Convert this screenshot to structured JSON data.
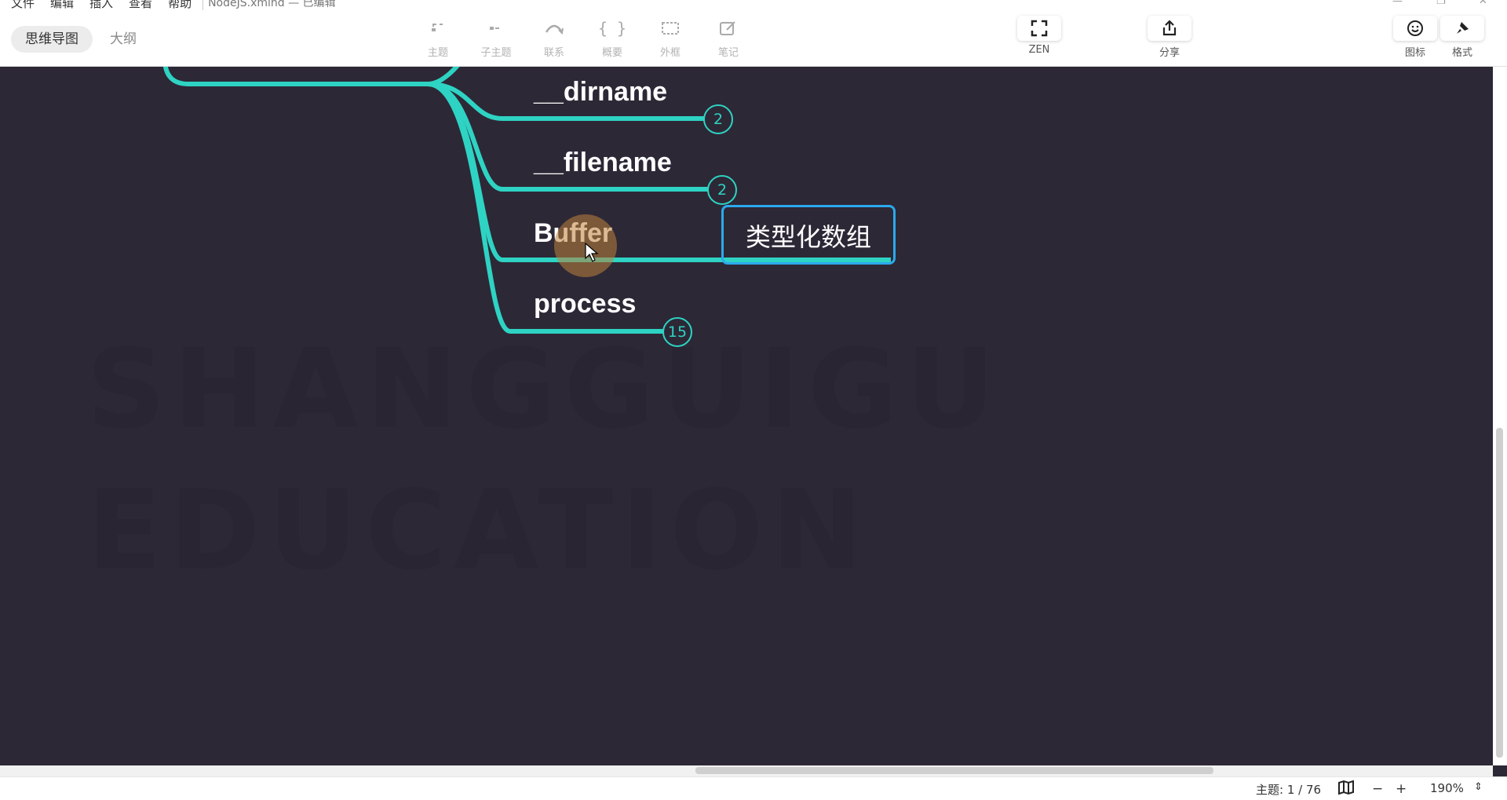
{
  "menu": {
    "file": "文件",
    "edit": "编辑",
    "insert": "插入",
    "view": "查看",
    "help": "帮助"
  },
  "window": {
    "title": "NodeJS.xmind — 已编辑"
  },
  "view_tabs": {
    "mindmap": "思维导图",
    "outline": "大纲"
  },
  "toolbar": {
    "topic": "主题",
    "subtopic": "子主题",
    "relationship": "联系",
    "summary": "概要",
    "boundary": "外框",
    "notes": "笔记",
    "zen": "ZEN",
    "share": "分享",
    "icons": "图标",
    "format": "格式"
  },
  "canvas": {
    "watermark_lines": [
      "",
      "SHANGGUIGU",
      "EDUCATION"
    ],
    "topics": [
      {
        "text": "__dirname",
        "badge": "2"
      },
      {
        "text": "__filename",
        "badge": "2"
      },
      {
        "text": "Buffer",
        "badge": ""
      },
      {
        "text": "process",
        "badge": "15"
      }
    ],
    "floating_topic": "类型化数组",
    "branch_color": "#2ed3c3",
    "selection_color": "#2ba9ee",
    "background": "#2d2836"
  },
  "status": {
    "topic_count": "主题: 1 / 76",
    "zoom": "190%"
  }
}
